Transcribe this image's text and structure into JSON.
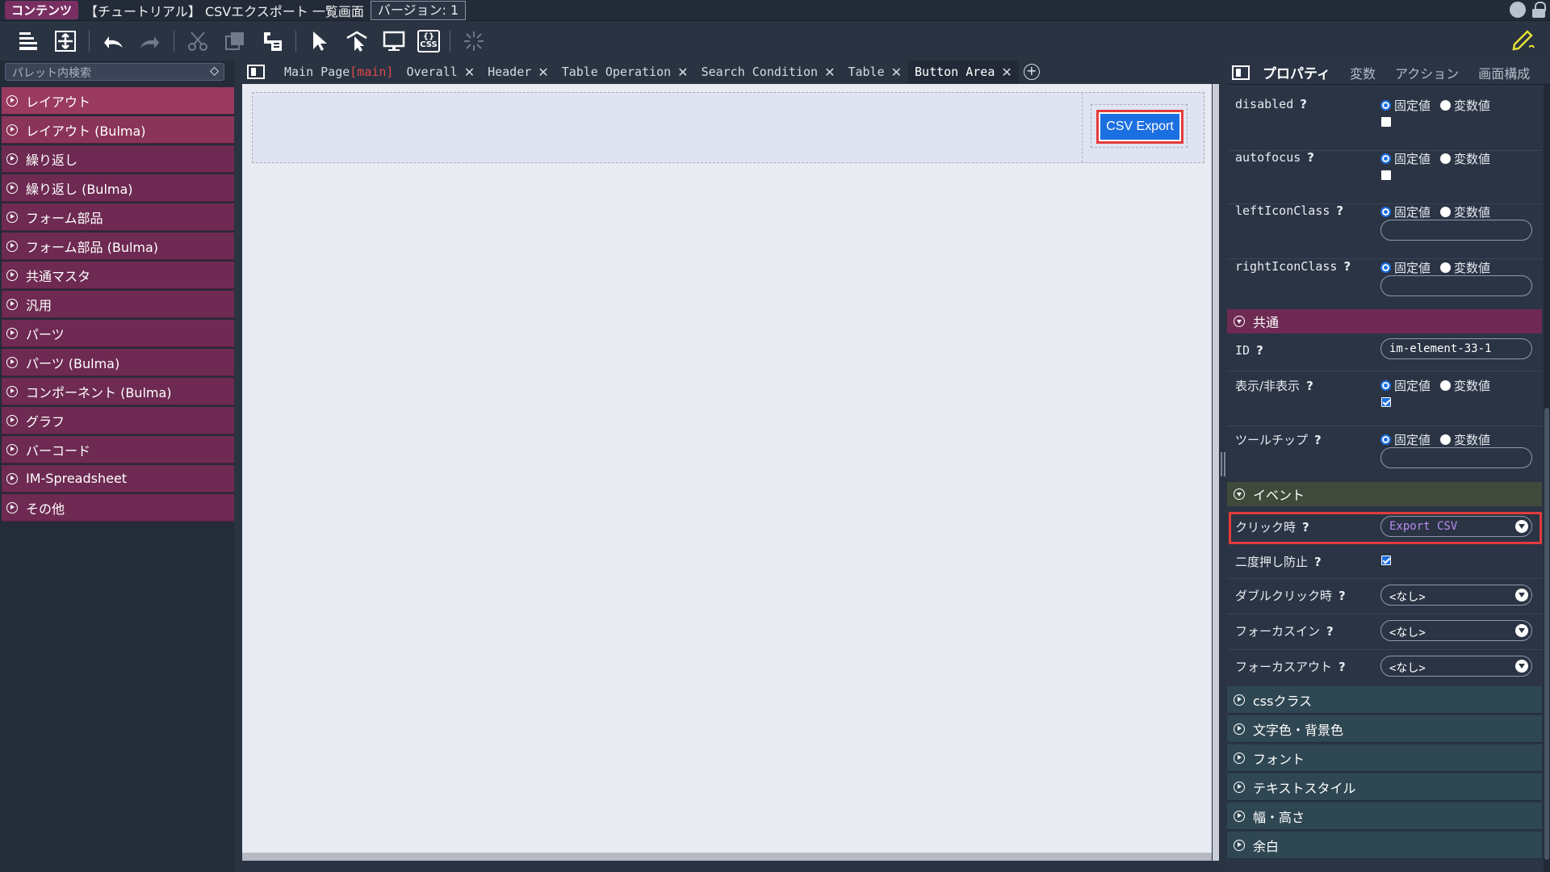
{
  "titlebar": {
    "badge": "コンテンツ",
    "title": "【チュートリアル】 CSVエクスポート 一覧画面",
    "version": "バージョン: 1"
  },
  "palette": {
    "search_placeholder": "パレット内検索",
    "items": [
      {
        "label": "レイアウト"
      },
      {
        "label": "レイアウト (Bulma)"
      },
      {
        "label": "繰り返し"
      },
      {
        "label": "繰り返し (Bulma)"
      },
      {
        "label": "フォーム部品"
      },
      {
        "label": "フォーム部品 (Bulma)"
      },
      {
        "label": "共通マスタ"
      },
      {
        "label": "汎用"
      },
      {
        "label": "パーツ"
      },
      {
        "label": "パーツ (Bulma)"
      },
      {
        "label": "コンポーネント (Bulma)"
      },
      {
        "label": "グラフ"
      },
      {
        "label": "バーコード"
      },
      {
        "label": "IM-Spreadsheet"
      },
      {
        "label": "その他"
      }
    ]
  },
  "tabs": {
    "main_page": "Main Page",
    "main_mark": "[main]",
    "items": [
      {
        "label": "Overall"
      },
      {
        "label": "Header"
      },
      {
        "label": "Table Operation"
      },
      {
        "label": "Search Condition"
      },
      {
        "label": "Table"
      },
      {
        "label": "Button Area"
      }
    ],
    "close_glyph": "✕",
    "add_glyph": "+"
  },
  "canvas": {
    "button_label": "CSV Export"
  },
  "right_panel": {
    "tabs": [
      "プロパティ",
      "変数",
      "アクション",
      "画面構成"
    ],
    "radio_fixed": "固定値",
    "radio_variable": "変数値",
    "q": "?",
    "props": {
      "disabled": "disabled",
      "autofocus": "autofocus",
      "leftIconClass": "leftIconClass",
      "rightIconClass": "rightIconClass",
      "id": "ID",
      "id_value": "im-element-33-1",
      "visible": "表示/非表示",
      "tooltip": "ツールチップ"
    },
    "sections": {
      "common": "共通",
      "event": "イベント",
      "css_class": "cssクラス",
      "color": "文字色・背景色",
      "font": "フォント",
      "text_style": "テキストスタイル",
      "size": "幅・高さ",
      "margin": "余白"
    },
    "events": {
      "click": "クリック時",
      "click_value": "Export CSV",
      "double_submit": "二度押し防止",
      "dblclick": "ダブルクリック時",
      "dblclick_value": "<なし>",
      "focusin": "フォーカスイン",
      "focusin_value": "<なし>",
      "focusout": "フォーカスアウト",
      "focusout_value": "<なし>"
    }
  },
  "icons": {
    "toolbar": [
      "save-icon",
      "import-icon",
      "undo-icon",
      "redo-icon",
      "cut-icon",
      "copy-icon",
      "paste-icon",
      "select-icon",
      "pointer-icon",
      "preview-icon",
      "css-icon",
      "loading-icon",
      "edit-icon"
    ]
  }
}
